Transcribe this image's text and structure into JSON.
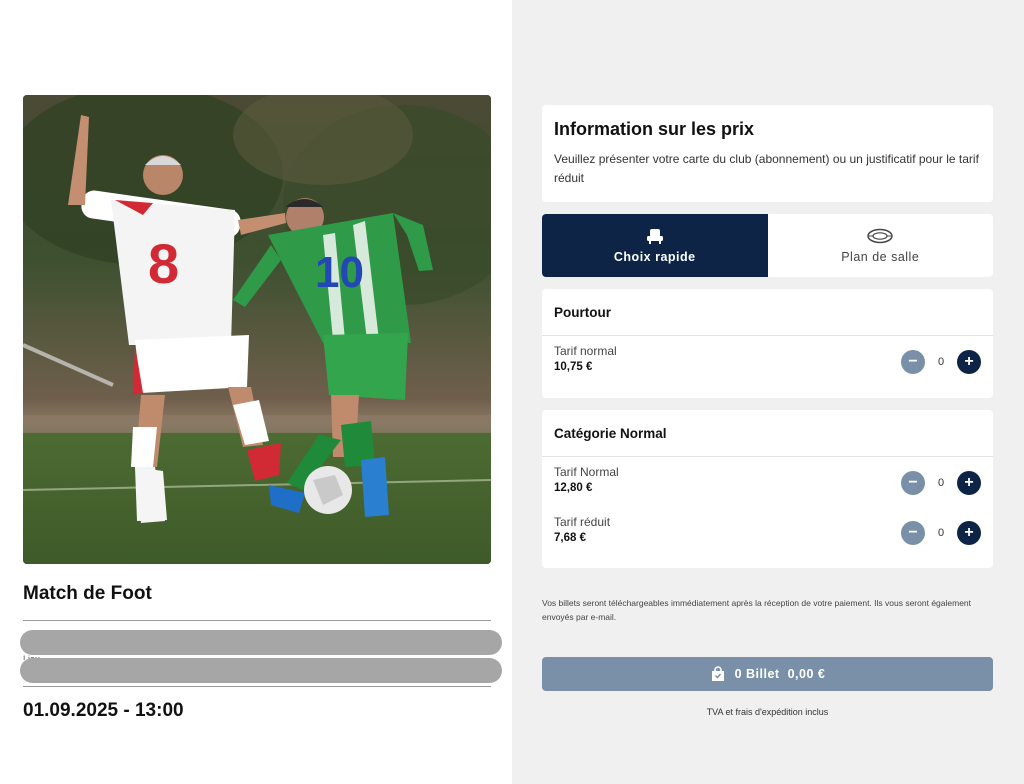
{
  "event": {
    "title": "Match de Foot",
    "peek_text": "Lieu",
    "date": "01.09.2025 - 13:00",
    "photo": {
      "home_kit": "#ffffff",
      "home_number": "8",
      "away_kit": "#2f9a48",
      "away_number": "10",
      "pitch": "#4a6a2f"
    }
  },
  "pricing_info": {
    "title": "Information sur les prix",
    "text": "Veuillez présenter votre carte du club (abonnement) ou un justificatif pour le tarif réduit"
  },
  "tabs": [
    {
      "label": "Choix rapide",
      "icon": "seat-icon",
      "active": true
    },
    {
      "label": "Plan de salle",
      "icon": "stadium-icon",
      "active": false
    }
  ],
  "categories": [
    {
      "name": "Pourtour",
      "tariffs": [
        {
          "name": "Tarif normal",
          "price": "10,75 €",
          "qty": "0"
        }
      ]
    },
    {
      "name": "Catégorie Normal",
      "tariffs": [
        {
          "name": "Tarif Normal",
          "price": "12,80 €",
          "qty": "0"
        },
        {
          "name": "Tarif réduit",
          "price": "7,68 €",
          "qty": "0"
        }
      ]
    }
  ],
  "stepper": {
    "minus": "−",
    "plus": "+"
  },
  "delivery_note": "Vos billets seront téléchargeables immédiatement après la réception de votre paiement. Ils vous seront également envoyés par e-mail.",
  "cart": {
    "count_label": "0 Billet",
    "total": "0,00 €",
    "icon": "shopping-bag-icon"
  },
  "tax_note": "TVA et frais d'expédition inclus",
  "colors": {
    "primary": "#0d2447",
    "muted_button": "#7a90a8",
    "panel_bg": "#f0f0f1",
    "placeholder": "#a6a6a6"
  }
}
